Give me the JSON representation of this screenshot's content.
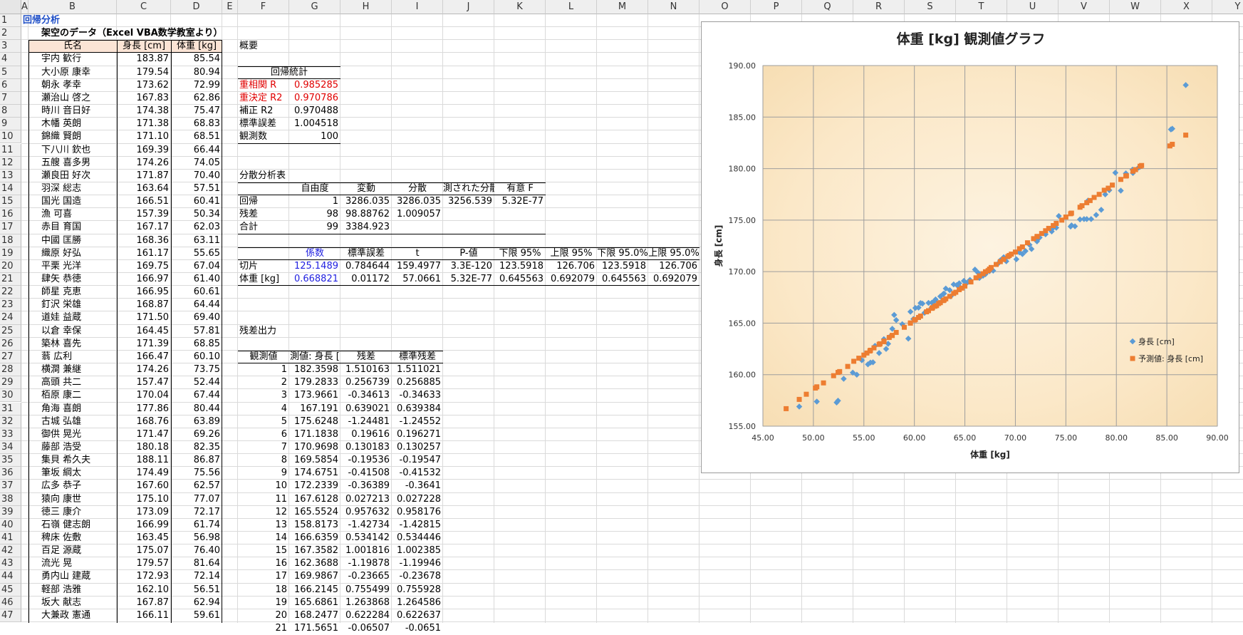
{
  "columns": [
    "A",
    "B",
    "C",
    "D",
    "E",
    "F",
    "G",
    "H",
    "I",
    "J",
    "K",
    "L",
    "M",
    "N",
    "O",
    "P",
    "Q",
    "R",
    "S",
    "T",
    "U",
    "V",
    "W",
    "X",
    "Y"
  ],
  "rows": [
    1,
    2,
    3,
    4,
    5,
    6,
    7,
    8,
    9,
    10,
    11,
    12,
    13,
    14,
    15,
    16,
    17,
    18,
    19,
    20,
    21,
    22,
    23,
    24,
    25,
    26,
    27,
    28,
    29,
    30,
    31,
    32,
    33,
    34,
    35,
    36,
    37,
    38,
    39,
    40,
    41,
    42,
    43,
    44,
    45,
    46,
    47
  ],
  "sheet_title": "回帰分析",
  "subtitle": "架空のデータ（Excel VBA数学教室より）",
  "data_headers": [
    "氏名",
    "身長 [cm]",
    "体重 [kg]"
  ],
  "people": [
    [
      "宇内 歓行",
      "183.87",
      "85.54"
    ],
    [
      "大小原 康幸",
      "179.54",
      "80.94"
    ],
    [
      "朝永 孝幸",
      "173.62",
      "72.99"
    ],
    [
      "瀬治山 啓之",
      "167.83",
      "62.86"
    ],
    [
      "時川 音日好",
      "174.38",
      "75.47"
    ],
    [
      "木幡 英朗",
      "171.38",
      "68.83"
    ],
    [
      "錦織 賢朗",
      "171.10",
      "68.51"
    ],
    [
      "下八川 欽也",
      "169.39",
      "66.44"
    ],
    [
      "五艘 喜多男",
      "174.26",
      "74.05"
    ],
    [
      "瀬良田 好次",
      "171.87",
      "70.40"
    ],
    [
      "羽深 総志",
      "163.64",
      "57.51"
    ],
    [
      "国光 国造",
      "166.51",
      "60.41"
    ],
    [
      "漁 可喜",
      "157.39",
      "50.34"
    ],
    [
      "赤目 育国",
      "167.17",
      "62.03"
    ],
    [
      "中國 匡勝",
      "168.36",
      "63.11"
    ],
    [
      "織原 好弘",
      "161.17",
      "55.65"
    ],
    [
      "平栗 光洋",
      "169.75",
      "67.04"
    ],
    [
      "肆矢 恭徳",
      "166.97",
      "61.40"
    ],
    [
      "師星 克恵",
      "166.95",
      "60.61"
    ],
    [
      "釘沢 栄雄",
      "168.87",
      "64.44"
    ],
    [
      "道娃 益蔵",
      "171.50",
      "69.40"
    ],
    [
      "以倉 幸保",
      "164.45",
      "57.81"
    ],
    [
      "築林 喜先",
      "171.39",
      "68.85"
    ],
    [
      "蓊 広利",
      "166.47",
      "60.10"
    ],
    [
      "横澗 兼継",
      "174.26",
      "73.75"
    ],
    [
      "高頭 共二",
      "157.47",
      "52.44"
    ],
    [
      "栢原 康二",
      "170.04",
      "67.44"
    ],
    [
      "角海 喜朗",
      "177.86",
      "80.44"
    ],
    [
      "古城 弘雄",
      "168.76",
      "63.89"
    ],
    [
      "御供 晃光",
      "171.47",
      "69.26"
    ],
    [
      "藤部 浩受",
      "180.18",
      "82.35"
    ],
    [
      "集貝 希久夫",
      "188.11",
      "86.87"
    ],
    [
      "筆坂 綱太",
      "174.49",
      "75.56"
    ],
    [
      "広多 恭子",
      "167.60",
      "62.57"
    ],
    [
      "猿向 康世",
      "175.10",
      "77.07"
    ],
    [
      "徳三 康介",
      "173.09",
      "72.17"
    ],
    [
      "石嶺 健志朗",
      "166.99",
      "61.74"
    ],
    [
      "稗床 佐敷",
      "163.45",
      "56.98"
    ],
    [
      "百足 源蔵",
      "175.07",
      "76.40"
    ],
    [
      "流光 晃",
      "179.57",
      "81.64"
    ],
    [
      "勇内山 建蔵",
      "172.93",
      "72.14"
    ],
    [
      "軽部 浩雅",
      "162.10",
      "56.51"
    ],
    [
      "坂大 献志",
      "167.87",
      "62.94"
    ],
    [
      "大兼政 憲通",
      "166.11",
      "59.61"
    ]
  ],
  "summary": {
    "title": "概要",
    "reg_stats_title": "回帰統計",
    "stats": [
      [
        "重相関 R",
        "0.985285"
      ],
      [
        "重決定 R2",
        "0.970786"
      ],
      [
        "補正 R2",
        "0.970488"
      ],
      [
        "標準誤差",
        "1.004518"
      ],
      [
        "観測数",
        "100"
      ]
    ],
    "anova_title": "分散分析表",
    "anova_headers": [
      "",
      "自由度",
      "変動",
      "分散",
      "測された分散",
      "有意 F"
    ],
    "anova_rows": [
      [
        "回帰",
        "1",
        "3286.035",
        "3286.035",
        "3256.539",
        "5.32E-77"
      ],
      [
        "残差",
        "98",
        "98.88762",
        "1.009057",
        "",
        ""
      ],
      [
        "合計",
        "99",
        "3384.923",
        "",
        "",
        ""
      ]
    ],
    "coef_headers": [
      "",
      "係数",
      "標準誤差",
      "t",
      "P-値",
      "下限 95%",
      "上限 95%",
      "下限 95.0%",
      "上限 95.0%"
    ],
    "coef_rows": [
      [
        "切片",
        "125.1489",
        "0.784644",
        "159.4977",
        "3.3E-120",
        "123.5918",
        "126.706",
        "123.5918",
        "126.706"
      ],
      [
        "体重 [kg]",
        "0.668821",
        "0.01172",
        "57.0661",
        "5.32E-77",
        "0.645563",
        "0.692079",
        "0.645563",
        "0.692079"
      ]
    ],
    "resid_title": "残差出力",
    "resid_headers": [
      "観測値",
      "測値: 身長 [",
      "残差",
      "標準残差"
    ],
    "resid_rows": [
      [
        "1",
        "182.3598",
        "1.510163",
        "1.511021"
      ],
      [
        "2",
        "179.2833",
        "0.256739",
        "0.256885"
      ],
      [
        "3",
        "173.9661",
        "-0.34613",
        "-0.34633"
      ],
      [
        "4",
        "167.191",
        "0.639021",
        "0.639384"
      ],
      [
        "5",
        "175.6248",
        "-1.24481",
        "-1.24552"
      ],
      [
        "6",
        "171.1838",
        "0.19616",
        "0.196271"
      ],
      [
        "7",
        "170.9698",
        "0.130183",
        "0.130257"
      ],
      [
        "8",
        "169.5854",
        "-0.19536",
        "-0.19547"
      ],
      [
        "9",
        "174.6751",
        "-0.41508",
        "-0.41532"
      ],
      [
        "10",
        "172.2339",
        "-0.36389",
        "-0.3641"
      ],
      [
        "11",
        "167.6128",
        "0.027213",
        "0.027228"
      ],
      [
        "12",
        "165.5524",
        "0.957632",
        "0.958176"
      ],
      [
        "13",
        "158.8173",
        "-1.42734",
        "-1.42815"
      ],
      [
        "14",
        "166.6359",
        "0.534142",
        "0.534446"
      ],
      [
        "15",
        "167.3582",
        "1.001816",
        "1.002385"
      ],
      [
        "16",
        "162.3688",
        "-1.19878",
        "-1.19946"
      ],
      [
        "17",
        "169.9867",
        "-0.23665",
        "-0.23678"
      ],
      [
        "18",
        "166.2145",
        "0.755499",
        "0.755928"
      ],
      [
        "19",
        "165.6861",
        "1.263868",
        "1.264586"
      ],
      [
        "20",
        "168.2477",
        "0.622284",
        "0.622637"
      ],
      [
        "21",
        "171.5651",
        "-0.06507",
        "-0.0651"
      ]
    ]
  },
  "chart_data": {
    "type": "scatter",
    "title": "体重 [kg] 観測値グラフ",
    "xlabel": "体重 [kg]",
    "ylabel": "身長 [cm]",
    "xlim": [
      45,
      90
    ],
    "ylim": [
      155,
      190
    ],
    "x_ticks": [
      "45.00",
      "50.00",
      "55.00",
      "60.00",
      "65.00",
      "70.00",
      "75.00",
      "80.00",
      "85.00",
      "90.00"
    ],
    "y_ticks": [
      "155.00",
      "160.00",
      "165.00",
      "170.00",
      "175.00",
      "180.00",
      "185.00",
      "190.00"
    ],
    "grid": true,
    "legend_position": "right",
    "series": [
      {
        "name": "身長 [cm]",
        "color": "#5b9bd5",
        "points": [
          [
            85.54,
            183.87
          ],
          [
            80.94,
            179.54
          ],
          [
            72.99,
            173.62
          ],
          [
            62.86,
            167.83
          ],
          [
            75.47,
            174.38
          ],
          [
            68.83,
            171.38
          ],
          [
            68.51,
            171.1
          ],
          [
            66.44,
            169.39
          ],
          [
            74.05,
            174.26
          ],
          [
            70.4,
            171.87
          ],
          [
            57.51,
            163.64
          ],
          [
            60.41,
            166.51
          ],
          [
            50.34,
            157.39
          ],
          [
            62.03,
            167.17
          ],
          [
            63.11,
            168.36
          ],
          [
            55.65,
            161.17
          ],
          [
            67.04,
            169.75
          ],
          [
            61.4,
            166.97
          ],
          [
            60.61,
            166.95
          ],
          [
            64.44,
            168.87
          ],
          [
            69.4,
            171.5
          ],
          [
            57.81,
            164.45
          ],
          [
            68.85,
            171.39
          ],
          [
            60.1,
            166.47
          ],
          [
            73.75,
            174.26
          ],
          [
            52.44,
            157.47
          ],
          [
            67.44,
            170.04
          ],
          [
            80.44,
            177.86
          ],
          [
            63.89,
            168.76
          ],
          [
            69.26,
            171.47
          ],
          [
            82.35,
            180.18
          ],
          [
            86.87,
            188.11
          ],
          [
            75.56,
            174.49
          ],
          [
            62.57,
            167.6
          ],
          [
            77.07,
            175.1
          ],
          [
            72.17,
            173.09
          ],
          [
            61.74,
            166.99
          ],
          [
            56.98,
            163.45
          ],
          [
            76.4,
            175.07
          ],
          [
            81.64,
            179.57
          ],
          [
            72.14,
            172.93
          ],
          [
            56.51,
            162.1
          ],
          [
            62.94,
            167.87
          ],
          [
            59.61,
            166.11
          ],
          [
            48.6,
            156.9
          ],
          [
            52.3,
            157.3
          ],
          [
            53.0,
            159.6
          ],
          [
            54.3,
            160.0
          ],
          [
            55.4,
            161.0
          ],
          [
            55.9,
            161.2
          ],
          [
            57.2,
            162.5
          ],
          [
            58.2,
            165.3
          ],
          [
            58.0,
            165.8
          ],
          [
            59.4,
            163.5
          ],
          [
            60.8,
            166.9
          ],
          [
            61.7,
            166.5
          ],
          [
            62.6,
            167.0
          ],
          [
            63.5,
            168.2
          ],
          [
            64.2,
            168.7
          ],
          [
            64.9,
            169.1
          ],
          [
            65.5,
            169.2
          ],
          [
            66.3,
            169.9
          ],
          [
            67.8,
            170.1
          ],
          [
            68.3,
            170.8
          ],
          [
            70.1,
            171.2
          ],
          [
            71.0,
            172.0
          ],
          [
            71.4,
            172.6
          ],
          [
            72.4,
            173.3
          ],
          [
            73.6,
            173.9
          ],
          [
            75.9,
            174.4
          ],
          [
            76.8,
            175.1
          ],
          [
            77.5,
            175.1
          ],
          [
            78.0,
            175.5
          ],
          [
            78.5,
            176.0
          ],
          [
            78.9,
            177.5
          ],
          [
            79.9,
            179.6
          ],
          [
            81.6,
            179.9
          ],
          [
            85.4,
            183.8
          ],
          [
            82.2,
            180.1
          ],
          [
            79.3,
            177.9
          ],
          [
            77.2,
            176.9
          ],
          [
            74.3,
            175.4
          ],
          [
            71.6,
            172.2
          ],
          [
            70.7,
            171.7
          ],
          [
            69.1,
            171.0
          ],
          [
            66.0,
            170.2
          ],
          [
            64.4,
            168.6
          ],
          [
            63.6,
            167.6
          ],
          [
            62.1,
            167.3
          ],
          [
            61.0,
            166.0
          ],
          [
            59.9,
            165.4
          ],
          [
            58.8,
            164.9
          ],
          [
            57.4,
            163.0
          ],
          [
            56.1,
            162.8
          ],
          [
            54.8,
            161.4
          ],
          [
            53.9,
            160.2
          ],
          [
            66.8,
            169.6
          ],
          [
            65.2,
            168.9
          ],
          [
            67.2,
            170.0
          ]
        ]
      },
      {
        "name": "予測値: 身長 [cm]",
        "color": "#ed7d31",
        "points": [
          [
            85.54,
            182.36
          ],
          [
            80.94,
            179.28
          ],
          [
            72.99,
            173.97
          ],
          [
            62.86,
            167.19
          ],
          [
            75.47,
            175.62
          ],
          [
            68.83,
            171.18
          ],
          [
            68.51,
            170.97
          ],
          [
            66.44,
            169.59
          ],
          [
            74.05,
            174.68
          ],
          [
            70.4,
            172.23
          ],
          [
            57.51,
            163.61
          ],
          [
            60.41,
            165.55
          ],
          [
            50.34,
            158.82
          ],
          [
            62.03,
            166.64
          ],
          [
            63.11,
            167.36
          ],
          [
            55.65,
            162.37
          ],
          [
            67.04,
            169.99
          ],
          [
            61.4,
            166.21
          ],
          [
            60.61,
            165.69
          ],
          [
            64.44,
            168.25
          ],
          [
            69.4,
            171.57
          ],
          [
            57.81,
            163.81
          ],
          [
            68.85,
            171.2
          ],
          [
            60.1,
            165.35
          ],
          [
            73.75,
            174.47
          ],
          [
            52.44,
            160.22
          ],
          [
            67.44,
            170.25
          ],
          [
            80.44,
            178.95
          ],
          [
            63.89,
            167.88
          ],
          [
            69.26,
            171.47
          ],
          [
            82.35,
            180.23
          ],
          [
            86.87,
            183.25
          ],
          [
            75.56,
            175.68
          ],
          [
            62.57,
            166.99
          ],
          [
            77.07,
            176.69
          ],
          [
            72.17,
            173.42
          ],
          [
            61.74,
            166.44
          ],
          [
            56.98,
            163.26
          ],
          [
            76.4,
            176.25
          ],
          [
            81.64,
            179.75
          ],
          [
            72.14,
            173.4
          ],
          [
            56.51,
            162.94
          ],
          [
            62.94,
            167.24
          ],
          [
            59.61,
            165.02
          ],
          [
            47.3,
            156.7
          ],
          [
            48.6,
            157.6
          ],
          [
            52.6,
            160.3
          ],
          [
            54.0,
            161.3
          ],
          [
            55.0,
            161.9
          ],
          [
            55.3,
            162.1
          ],
          [
            56.0,
            162.6
          ],
          [
            57.0,
            163.2
          ],
          [
            58.2,
            164.1
          ],
          [
            59.6,
            165.0
          ],
          [
            61.2,
            166.1
          ],
          [
            62.2,
            166.7
          ],
          [
            63.5,
            167.6
          ],
          [
            64.7,
            168.4
          ],
          [
            65.6,
            169.0
          ],
          [
            66.1,
            169.4
          ],
          [
            66.8,
            169.8
          ],
          [
            67.6,
            170.4
          ],
          [
            68.1,
            170.7
          ],
          [
            70.0,
            171.9
          ],
          [
            71.2,
            172.8
          ],
          [
            71.8,
            173.2
          ],
          [
            72.6,
            173.7
          ],
          [
            73.3,
            174.2
          ],
          [
            75.0,
            175.3
          ],
          [
            76.6,
            176.4
          ],
          [
            77.4,
            176.9
          ],
          [
            77.8,
            177.2
          ],
          [
            78.3,
            177.5
          ],
          [
            78.8,
            177.9
          ],
          [
            79.2,
            178.1
          ],
          [
            79.6,
            178.4
          ],
          [
            81.0,
            179.3
          ],
          [
            81.9,
            179.9
          ],
          [
            82.5,
            180.3
          ],
          [
            85.3,
            182.2
          ],
          [
            74.6,
            175.0
          ],
          [
            70.7,
            172.4
          ],
          [
            69.6,
            171.7
          ],
          [
            67.3,
            170.1
          ],
          [
            65.0,
            168.6
          ],
          [
            64.1,
            168.0
          ],
          [
            62.4,
            166.9
          ],
          [
            61.8,
            166.5
          ],
          [
            60.0,
            165.3
          ],
          [
            59.0,
            164.6
          ],
          [
            57.8,
            163.8
          ],
          [
            56.6,
            163.0
          ],
          [
            55.6,
            162.3
          ],
          [
            54.5,
            161.6
          ],
          [
            53.4,
            160.8
          ],
          [
            52.0,
            159.9
          ],
          [
            51.0,
            159.2
          ],
          [
            50.2,
            158.7
          ],
          [
            49.3,
            158.1
          ]
        ]
      }
    ]
  }
}
